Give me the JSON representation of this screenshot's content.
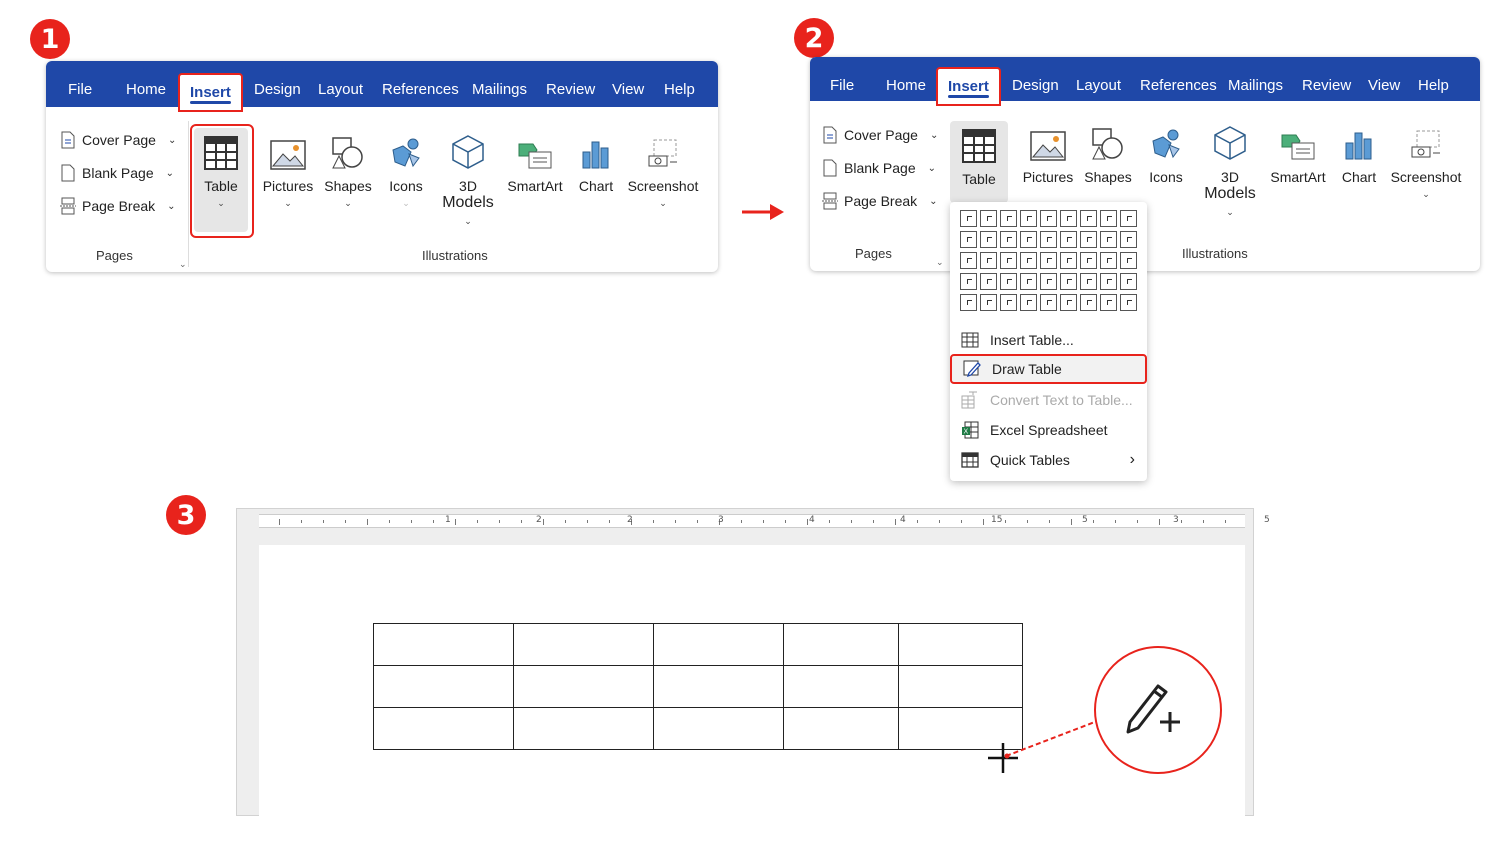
{
  "steps": [
    "1",
    "2",
    "3"
  ],
  "ribbon": {
    "tabs": [
      "File",
      "Home",
      "Insert",
      "Design",
      "Layout",
      "References",
      "Mailings",
      "Review",
      "View",
      "Help"
    ],
    "pages_group": {
      "items": [
        "Cover Page",
        "Blank Page",
        "Page Break"
      ],
      "label": "Pages"
    },
    "illustrations_group": {
      "buttons": {
        "table": "Table",
        "pictures": "Pictures",
        "shapes": "Shapes",
        "icons": "Icons",
        "models_line1": "3D",
        "models_line2": "Models",
        "smartart": "SmartArt",
        "chart": "Chart",
        "screenshot": "Screenshot"
      },
      "label": "Illustrations"
    }
  },
  "table_menu": {
    "grid_rows": 5,
    "grid_cols": 9,
    "items": [
      {
        "label": "Insert Table...",
        "icon": "table-grid-icon",
        "state": "normal"
      },
      {
        "label": "Draw Table",
        "icon": "draw-table-pencil-icon",
        "state": "selected"
      },
      {
        "label": "Convert Text to Table...",
        "icon": "convert-text-icon",
        "state": "disabled"
      },
      {
        "label": "Excel Spreadsheet",
        "icon": "excel-icon",
        "state": "normal"
      },
      {
        "label": "Quick Tables",
        "icon": "quick-tables-icon",
        "state": "submenu"
      }
    ]
  },
  "document": {
    "ruler_labels": [
      "1",
      "2",
      "2",
      "3",
      "4",
      "4",
      "15",
      "5",
      "3",
      "5"
    ],
    "drawn_table": {
      "rows": 3,
      "cols": 5
    },
    "cursor": "crosshair-plus",
    "zoom_icon": "pencil-plus-icon"
  },
  "colors": {
    "accent": "#e8231c",
    "ribbon_blue": "#1f48a8"
  }
}
